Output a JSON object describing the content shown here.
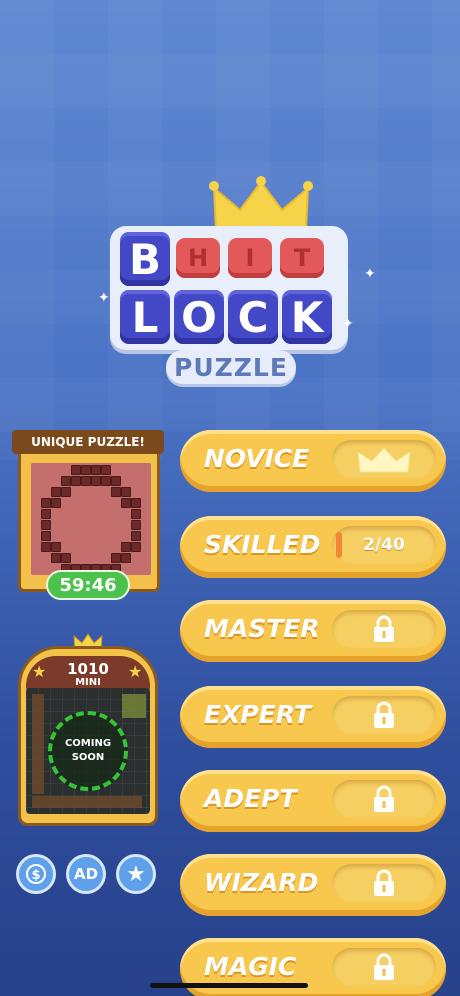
{
  "logo": {
    "row1": [
      "B",
      "H",
      "I",
      "T"
    ],
    "row2": [
      "L",
      "O",
      "C",
      "K"
    ],
    "subtitle": "PUZZLE"
  },
  "unique_puzzle": {
    "banner": "UNIQUE PUZZLE!",
    "timer": "59:46"
  },
  "mini": {
    "title": "1010",
    "subtitle": "MINI",
    "status_line1": "COMING",
    "status_line2": "SOON"
  },
  "round_buttons": [
    {
      "icon": "no-ads-dollar-icon"
    },
    {
      "icon": "no-ads-icon",
      "label": "AD"
    },
    {
      "icon": "star-icon"
    }
  ],
  "levels": [
    {
      "label": "NOVICE",
      "state": "completed",
      "icon": "crown-icon"
    },
    {
      "label": "SKILLED",
      "state": "in-progress",
      "progress_text": "2/40",
      "progress_fraction": 0.05
    },
    {
      "label": "MASTER",
      "state": "locked",
      "icon": "lock-icon"
    },
    {
      "label": "EXPERT",
      "state": "locked",
      "icon": "lock-icon"
    },
    {
      "label": "ADEPT",
      "state": "locked",
      "icon": "lock-icon"
    },
    {
      "label": "WIZARD",
      "state": "locked",
      "icon": "lock-icon"
    },
    {
      "label": "MAGIC",
      "state": "locked",
      "icon": "lock-icon"
    }
  ],
  "colors": {
    "background": "#4a72c4",
    "level_button": "#f8c74e",
    "timer_green": "#4bc24b",
    "logo_blue": "#4348c6",
    "logo_red": "#e35959"
  }
}
